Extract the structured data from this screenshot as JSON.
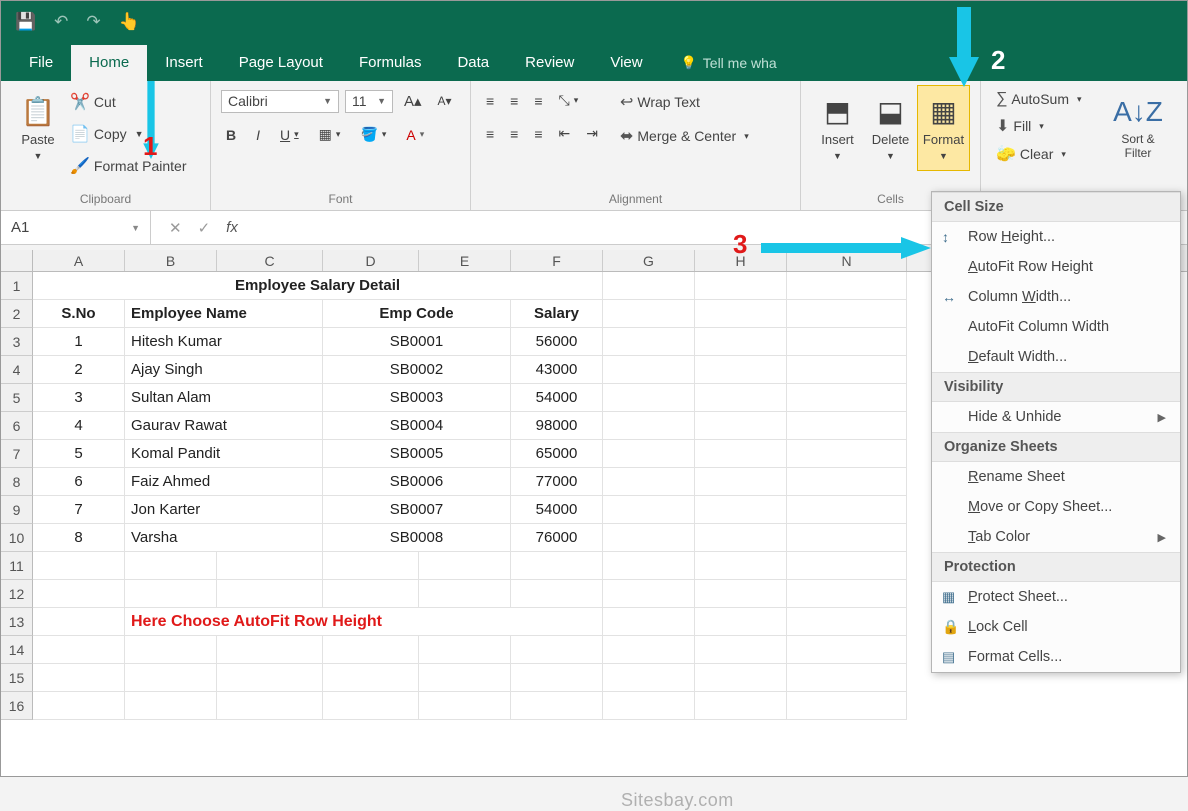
{
  "qat": {
    "save": "💾",
    "undo": "↶",
    "redo": "↷",
    "touch": "👆"
  },
  "tabs": {
    "file": "File",
    "home": "Home",
    "insert": "Insert",
    "page_layout": "Page Layout",
    "formulas": "Formulas",
    "data": "Data",
    "review": "Review",
    "view": "View",
    "tellme": "Tell me wha"
  },
  "ribbon": {
    "paste": "Paste",
    "cut": "Cut",
    "copy": "Copy",
    "format_painter": "Format Painter",
    "clipboard": "Clipboard",
    "font_name": "Calibri",
    "font_size": "11",
    "font_group": "Font",
    "wrap": "Wrap Text",
    "merge": "Merge & Center",
    "align_group": "Alignment",
    "insert": "Insert",
    "delete": "Delete",
    "format": "Format",
    "cells_group": "Cells",
    "autosum": "AutoSum",
    "fill": "Fill",
    "clear": "Clear",
    "sort": "Sort & Filter"
  },
  "formula": {
    "cell": "A1",
    "fx": "fx"
  },
  "columns": [
    "A",
    "B",
    "C",
    "D",
    "E",
    "F",
    "G",
    "H",
    "N"
  ],
  "colwidths": [
    "wA",
    "wB",
    "wC",
    "wD",
    "wE",
    "wF",
    "wG",
    "wH",
    "wN"
  ],
  "sheet": {
    "title": "Employee Salary Detail",
    "headers": {
      "sno": "S.No",
      "name": "Employee Name",
      "code": "Emp Code",
      "salary": "Salary"
    },
    "rows": [
      {
        "n": "1",
        "name": "Hitesh Kumar",
        "code": "SB0001",
        "sal": "56000"
      },
      {
        "n": "2",
        "name": "Ajay Singh",
        "code": "SB0002",
        "sal": "43000"
      },
      {
        "n": "3",
        "name": "Sultan Alam",
        "code": "SB0003",
        "sal": "54000"
      },
      {
        "n": "4",
        "name": "Gaurav Rawat",
        "code": "SB0004",
        "sal": "98000"
      },
      {
        "n": "5",
        "name": "Komal Pandit",
        "code": "SB0005",
        "sal": "65000"
      },
      {
        "n": "6",
        "name": "Faiz Ahmed",
        "code": "SB0006",
        "sal": "77000"
      },
      {
        "n": "7",
        "name": "Jon Karter",
        "code": "SB0007",
        "sal": "54000"
      },
      {
        "n": "8",
        "name": "Varsha",
        "code": "SB0008",
        "sal": "76000"
      }
    ],
    "note": "Here Choose AutoFit Row Height",
    "watermark": "Sitesbay.com"
  },
  "menu": {
    "cell_size": "Cell Size",
    "row_height": "Row Height...",
    "autofit_row": "AutoFit Row Height",
    "col_width": "Column Width...",
    "autofit_col": "AutoFit Column Width",
    "default_width": "Default Width...",
    "visibility": "Visibility",
    "hide": "Hide & Unhide",
    "organize": "Organize Sheets",
    "rename": "Rename Sheet",
    "move": "Move or Copy Sheet...",
    "tabcolor": "Tab Color",
    "protection": "Protection",
    "protect": "Protect Sheet...",
    "lock": "Lock Cell",
    "format_cells": "Format Cells..."
  },
  "annotations": {
    "one": "1",
    "two": "2",
    "three": "3"
  }
}
